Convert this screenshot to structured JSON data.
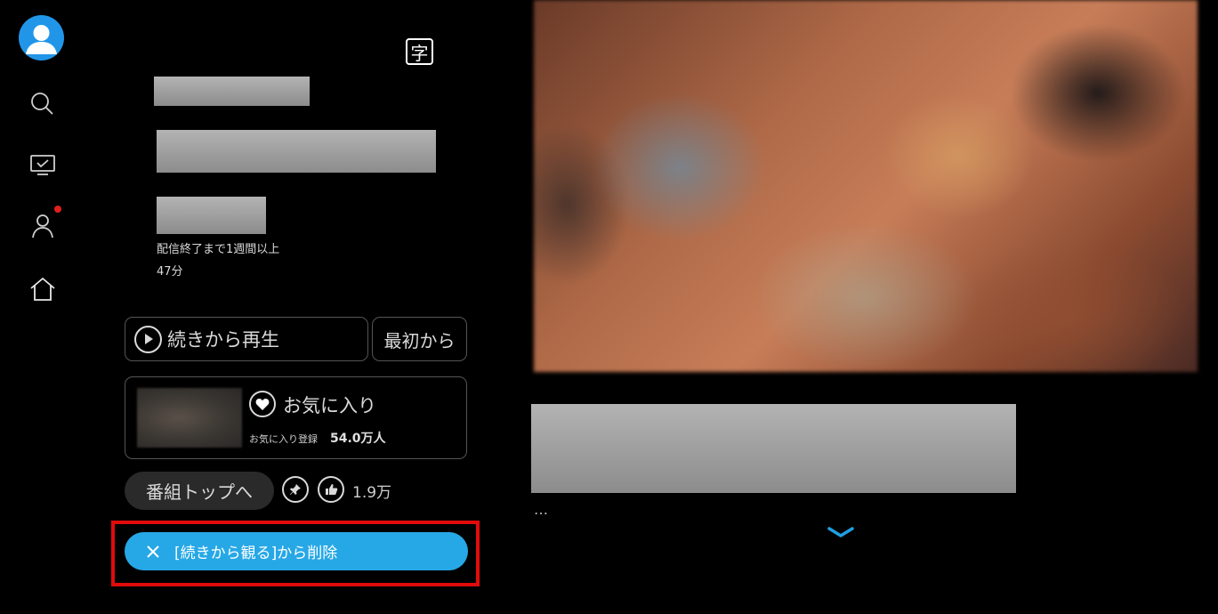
{
  "sidebar": {
    "items": [
      {
        "icon": "search-icon"
      },
      {
        "icon": "tv-list-icon"
      },
      {
        "icon": "profile-icon",
        "has_notification": true
      },
      {
        "icon": "home-icon"
      }
    ],
    "accent_color": "#2196e8",
    "notification_color": "#e0201d"
  },
  "details": {
    "subtitle_badge": "字",
    "availability": "配信終了まで1週間以上",
    "duration": "47分"
  },
  "actions": {
    "resume_label": "続きから再生",
    "from_start_label": "最初から",
    "favorite_label": "お気に入り",
    "favorite_count_label": "お気に入り登録",
    "favorite_count": "54.0万人",
    "program_top_label": "番組トップへ",
    "like_count": "1.9万",
    "remove_label": "[続きから観る]から削除",
    "remove_color": "#27a8e6"
  },
  "main": {
    "description_more": "…"
  }
}
